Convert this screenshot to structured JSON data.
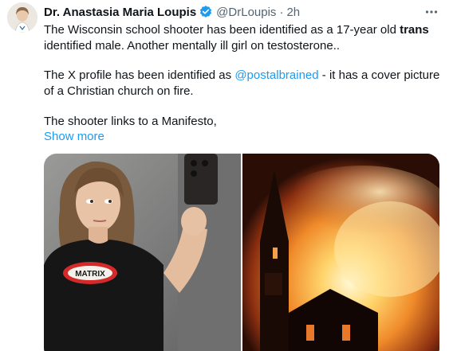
{
  "author": {
    "display_name": "Dr. Anastasia Maria Loupis",
    "handle": "@DrLoupis",
    "separator": "·",
    "time": "2h"
  },
  "post": {
    "line1_before": "The Wisconsin school shooter has been identified as a 17-year old ",
    "line1_bold": "trans",
    "line2": "identified male. Another mentally ill girl on testosterone..",
    "line3_before": "The X profile has been identified as ",
    "line3_link": "@postalbrained",
    "line3_after": " - it has a cover picture",
    "line4": "of a Christian church on fire.",
    "line5": "The shooter links to a Manifesto,",
    "show_more": "Show more"
  },
  "icons": {
    "verified": "verified-badge-icon",
    "more": "more-options-icon"
  },
  "colors": {
    "link": "#1d9bf0",
    "secondary_text": "#536471",
    "primary_text": "#0f1419"
  },
  "media": {
    "left_shirt_text": "MATRIX"
  }
}
